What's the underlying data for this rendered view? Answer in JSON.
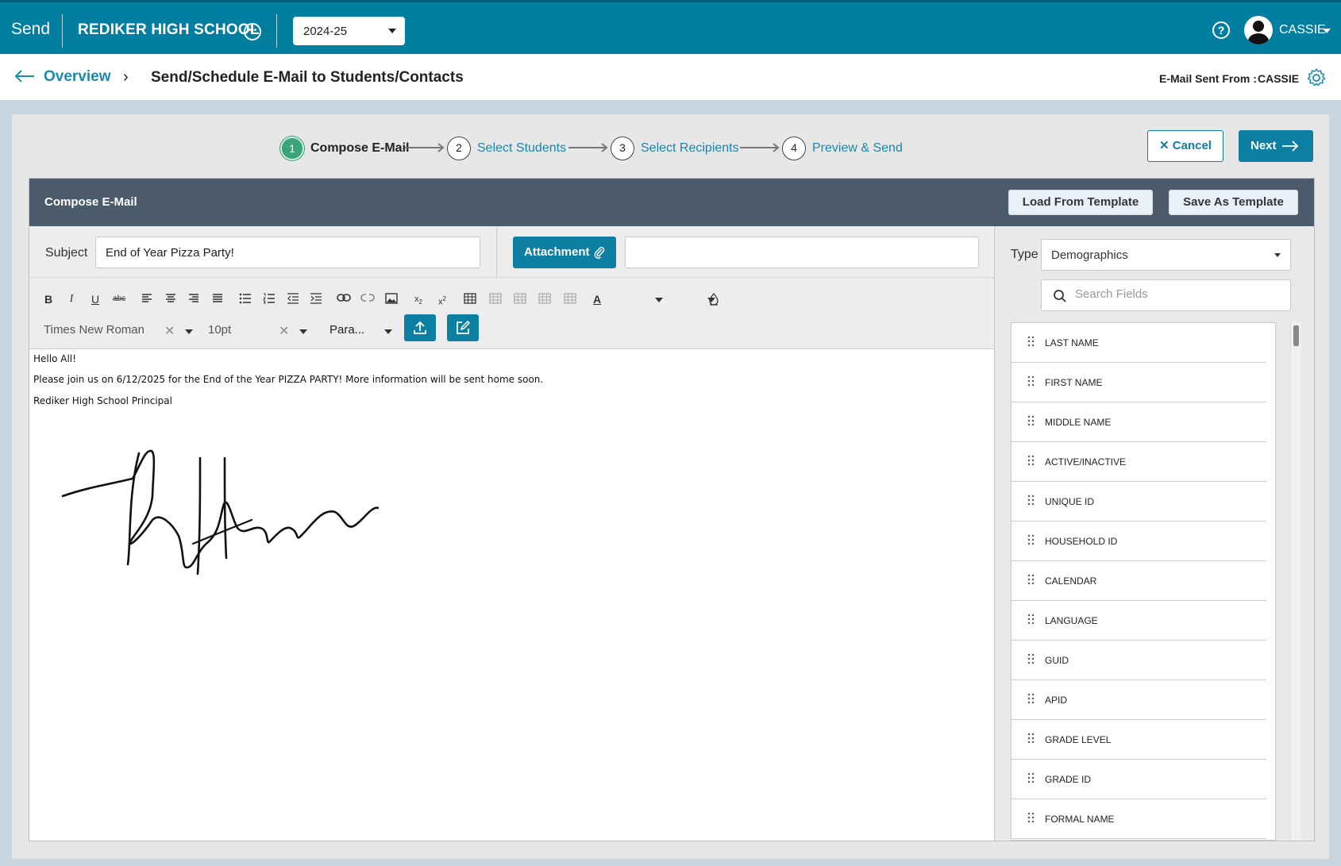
{
  "topbar": {
    "app_name": "Send",
    "school_name": "REDIKER HIGH SCHOOL",
    "school_year": "2024-25",
    "user_name": "CASSIE"
  },
  "breadcrumb": {
    "overview": "Overview",
    "title": "Send/Schedule E-Mail to Students/Contacts",
    "sent_from_label": "E-Mail Sent From :",
    "sent_from_value": "CASSIE"
  },
  "stepper": {
    "steps": [
      {
        "num": "1",
        "label": "Compose E-Mail",
        "active": true
      },
      {
        "num": "2",
        "label": "Select Students",
        "active": false
      },
      {
        "num": "3",
        "label": "Select Recipients",
        "active": false
      },
      {
        "num": "4",
        "label": "Preview & Send",
        "active": false
      }
    ],
    "cancel_label": "Cancel",
    "next_label": "Next"
  },
  "compose": {
    "header_title": "Compose E-Mail",
    "load_template_label": "Load From Template",
    "save_template_label": "Save As Template",
    "subject_label": "Subject",
    "subject_value": "End of Year Pizza Party!",
    "attachment_label": "Attachment",
    "attachment_value": "",
    "font_family": "Times New Roman",
    "font_size": "10pt",
    "paragraph_format": "Para...",
    "body_lines": [
      "Hello All!",
      "Please join us on 6/12/2025 for the End of the Year PIZZA PARTY! More information will be sent home soon.",
      "Rediker High School Principal"
    ]
  },
  "fields": {
    "type_label": "Type",
    "type_value": "Demographics",
    "search_placeholder": "Search Fields",
    "items": [
      "LAST NAME",
      "FIRST NAME",
      "MIDDLE NAME",
      "ACTIVE/INACTIVE",
      "UNIQUE ID",
      "HOUSEHOLD ID",
      "CALENDAR",
      "LANGUAGE",
      "GUID",
      "APID",
      "GRADE LEVEL",
      "GRADE ID",
      "FORMAL NAME"
    ]
  },
  "colors": {
    "brand": "#027ea1",
    "accent_button": "#0d7fa3",
    "step_active": "#3aa37a",
    "card_header": "#4b5b6b"
  }
}
